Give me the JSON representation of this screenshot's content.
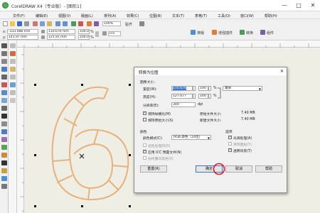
{
  "window": {
    "title": "CorelDRAW X4（专业版）- [图形1]",
    "minimize": "—",
    "maximize": "□",
    "close": "✕"
  },
  "menubar": {
    "items": [
      "文件(F)",
      "编辑(E)",
      "视图(V)",
      "版面(L)",
      "排列(A)",
      "效果(C)",
      "位图(B)",
      "文本(T)",
      "表格(T)",
      "工具(O)",
      "窗口(W)",
      "帮助(H)"
    ]
  },
  "toolbar": {
    "zoom_value": "100%",
    "snap_label": "贴齐",
    "plugin_labels": [
      "排版",
      "增强插件",
      "转换",
      "组件"
    ]
  },
  "property_bar": {
    "x": "-333.088 mm",
    "y": "141.97 mm",
    "width": "110.676 mm",
    "height": "125.91 mm",
    "scale_x": "100.0",
    "scale_y": "100.0",
    "percent": "%",
    "angle": "0.0"
  },
  "dialog": {
    "title": "转换为位图",
    "close_icon": "✕",
    "image_size_label": "图像大小:",
    "width_label": "宽度(W):",
    "width_value": "110.676",
    "width_pct": "100",
    "height_label": "高度(H):",
    "height_value": "127.677",
    "height_pct": "100",
    "pct_unit": "%",
    "unit_value": "毫米",
    "resolution_label": "分辨率(E):",
    "resolution_value": "300",
    "resolution_unit": "dpi",
    "keep_ratio_label": "保持纵横比(M)",
    "keep_ratio_checked": true,
    "keep_size_label": "保持原始大小(S)",
    "keep_size_checked": false,
    "original_size_label": "原始文件大小:",
    "original_size_value": "7.40 MB",
    "new_size_label": "新建文件大小:",
    "new_size_value": "7.40 MB",
    "color_group_label": "颜色",
    "color_mode_label": "颜色模式(C):",
    "color_mode_value": "RGB 颜色（24位）",
    "dither_label": "递色处理的(D)",
    "dither_checked": false,
    "icc_label": "应用 ICC 预置文件(N)",
    "icc_checked": true,
    "always_overprint_label": "始终叠印黑色(V)",
    "always_overprint_checked": false,
    "options_group_label": "选项",
    "antialias_label": "光滑处理(A)",
    "antialias_checked": true,
    "keep_layers_label": "保持图层(Y)",
    "keep_layers_checked": false,
    "transparent_label": "透明背景(T)",
    "transparent_checked": true,
    "reset_button": "重置(R)",
    "ok_button": "确定",
    "cancel_button": "取消",
    "help_button": "帮助"
  },
  "colors": {
    "shape_stroke": "#e8b27a",
    "highlight_circle": "#e0141e",
    "accent": "#3a78d8"
  }
}
